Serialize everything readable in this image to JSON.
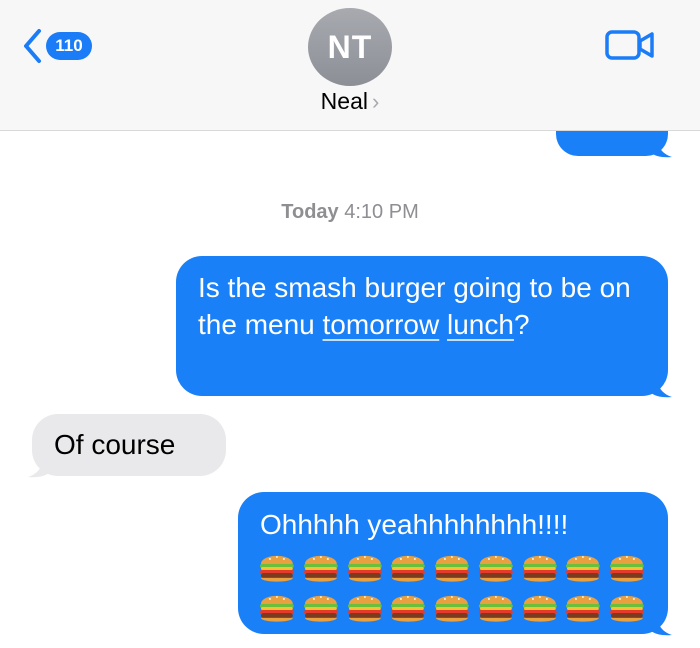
{
  "header": {
    "back_count": "110",
    "avatar_initials": "NT",
    "contact_name": "Neal",
    "chevron": "›"
  },
  "timestamp": {
    "day": "Today",
    "time": "4:10 PM"
  },
  "messages": [
    {
      "direction": "outgoing",
      "text_before": "Is the smash burger going to be on the menu ",
      "link_1": "tomorrow",
      "link_2": "lunch",
      "text_after": "?"
    },
    {
      "direction": "incoming",
      "text": "Of course"
    },
    {
      "direction": "outgoing",
      "text": "Ohhhhh yeahhhhhhhh!!!!",
      "emoji": "🍔"
    }
  ],
  "colors": {
    "outgoing_bubble": "#1a80f7",
    "incoming_bubble": "#e9e9eb",
    "accent": "#1a7cf6"
  },
  "icons": [
    "back-chevron-icon",
    "video-camera-icon",
    "burger-emoji-icon"
  ]
}
